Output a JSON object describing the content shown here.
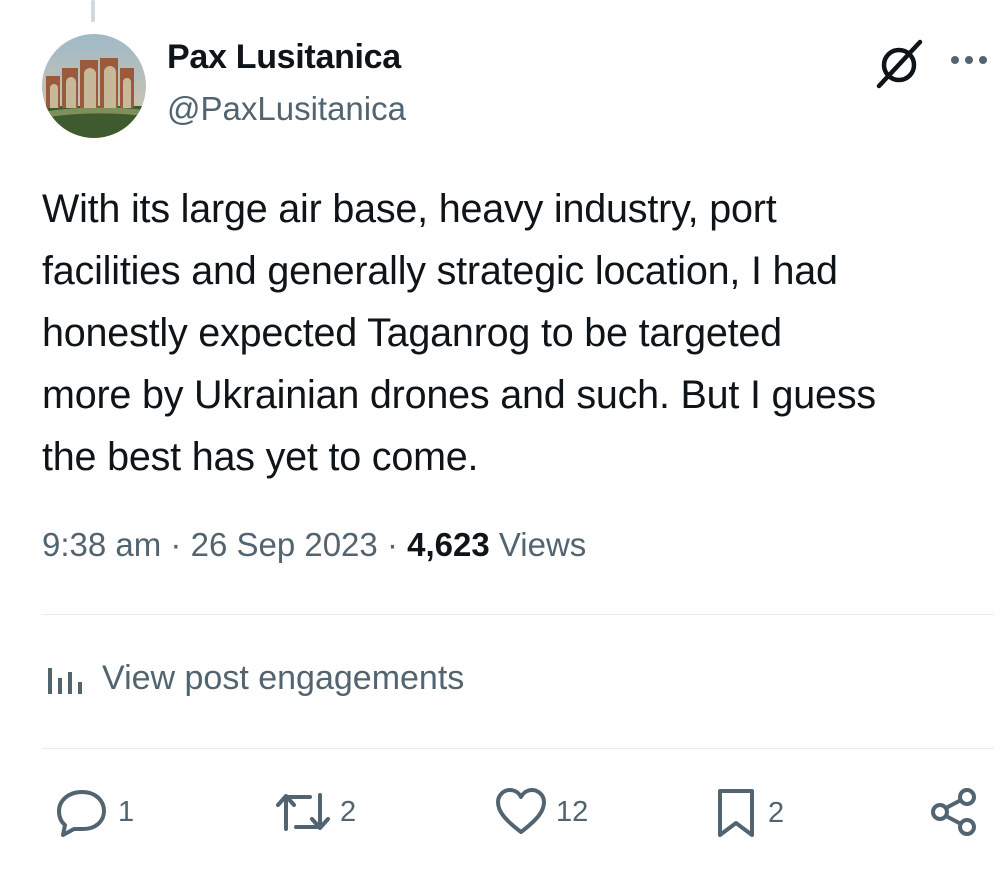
{
  "author": {
    "display_name": "Pax Lusitanica",
    "handle": "@PaxLusitanica"
  },
  "post": {
    "lines": [
      "With its large air base, heavy industry, port",
      "facilities and generally strategic location, I had",
      "honestly expected Taganrog to be targeted",
      "more by Ukrainian drones and such. But I guess",
      "the best has yet to come."
    ],
    "time": "9:38 am",
    "separator": "·",
    "date": "26 Sep 2023",
    "views_count": "4,623",
    "views_label": "Views"
  },
  "engagements_link": "View post engagements",
  "actions": {
    "replies": "1",
    "reposts": "2",
    "likes": "12",
    "bookmarks": "2"
  },
  "icons": {
    "header": [
      "grok-icon",
      "more-icon"
    ],
    "actions": [
      "reply-icon",
      "repost-icon",
      "like-icon",
      "bookmark-icon",
      "share-icon"
    ],
    "engagements": "analytics-icon"
  },
  "colors": {
    "text_primary": "#0f1419",
    "text_secondary": "#536471",
    "divider": "#e6ecf0"
  }
}
